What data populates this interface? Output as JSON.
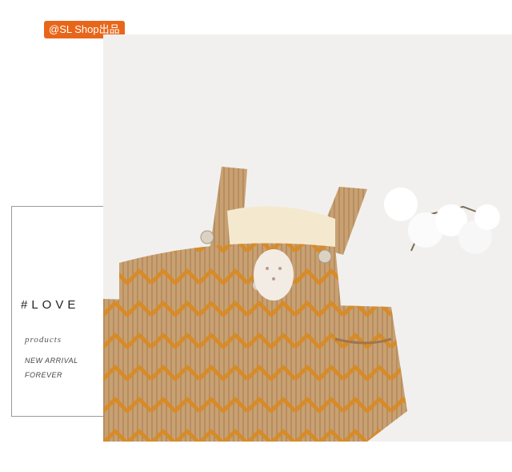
{
  "badge": {
    "text": "@SL Shop出品"
  },
  "tagline": {
    "love": "#LOVE",
    "products": "products",
    "new_arrival": "NEW ARRIVAL",
    "forever": "FOREVER"
  },
  "photo": {
    "subject": "corduroy-overalls"
  },
  "colors": {
    "badge": "#e8661a",
    "fabric": "#c79a6a",
    "zigzag": "#d98a22",
    "background": "#f1f0ee"
  }
}
